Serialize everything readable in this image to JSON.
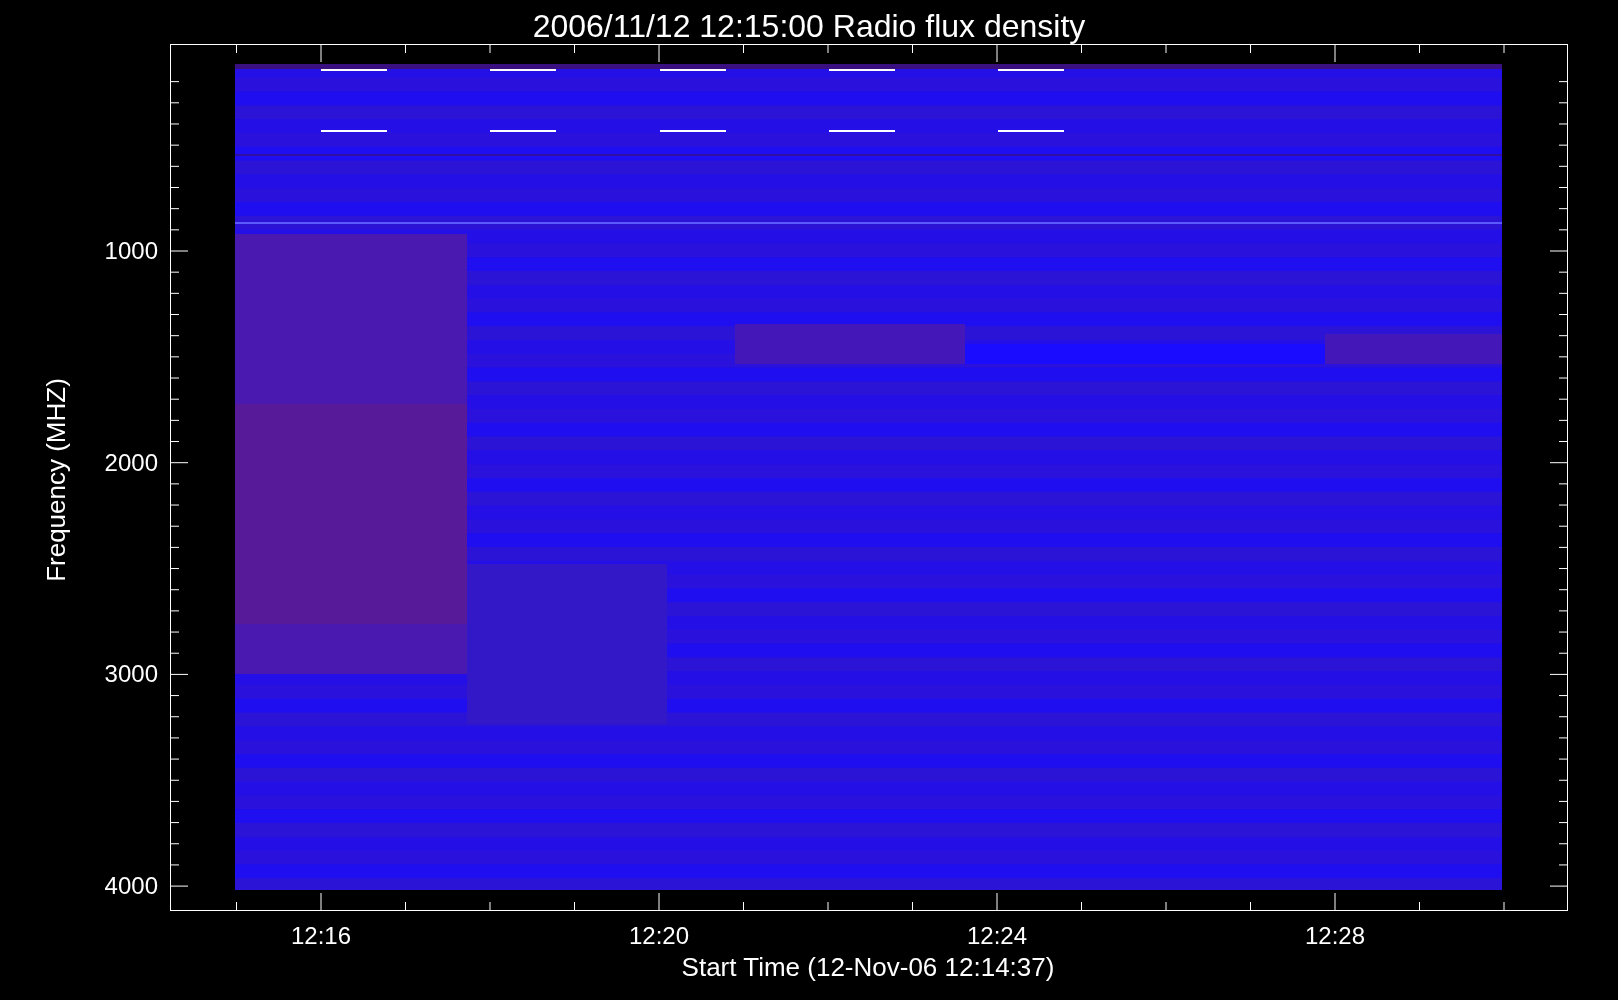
{
  "title": "2006/11/12 12:15:00 Radio flux density",
  "y_axis": {
    "label": "Frequency (MHZ)",
    "ticks": [
      "1000",
      "2000",
      "3000",
      "4000"
    ]
  },
  "x_axis": {
    "label": "Start Time (12-Nov-06 12:14:37)",
    "ticks": [
      "12:16",
      "12:20",
      "12:24",
      "12:28"
    ]
  }
}
